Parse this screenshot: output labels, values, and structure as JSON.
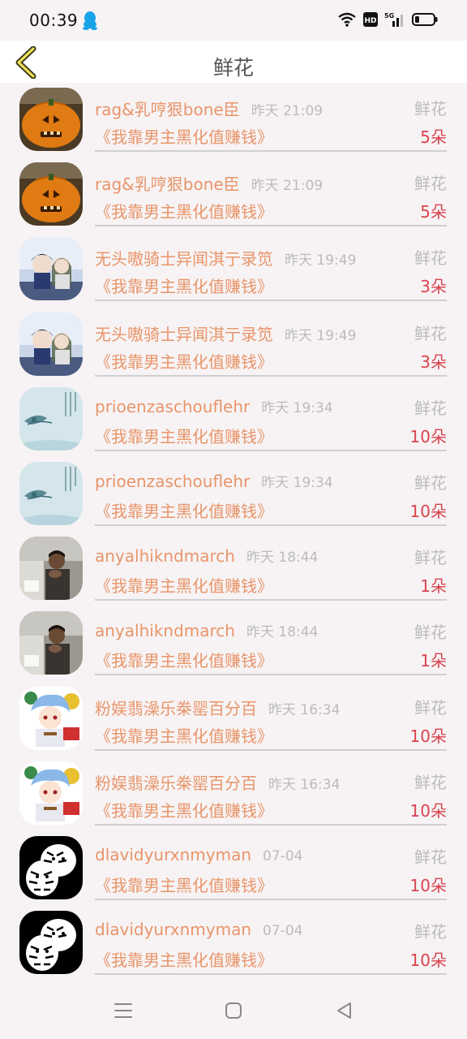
{
  "status": {
    "time": "00:39"
  },
  "header": {
    "title": "鲜花"
  },
  "items": [
    {
      "name": "rag&乳哼狠bone臣",
      "time": "昨天 21:09",
      "type": "鲜花",
      "book": "《我靠男主黑化值赚钱》",
      "count": "5朵",
      "avatar": "pumpkin"
    },
    {
      "name": "rag&乳哼狠bone臣",
      "time": "昨天 21:09",
      "type": "鲜花",
      "book": "《我靠男主黑化值赚钱》",
      "count": "5朵",
      "avatar": "pumpkin"
    },
    {
      "name": "无头嗷骑士异闻淇亍录笕",
      "time": "昨天 19:49",
      "type": "鲜花",
      "book": "《我靠男主黑化值赚钱》",
      "count": "3朵",
      "avatar": "anime-couple"
    },
    {
      "name": "无头嗷骑士异闻淇亍录笕",
      "time": "昨天 19:49",
      "type": "鲜花",
      "book": "《我靠男主黑化值赚钱》",
      "count": "3朵",
      "avatar": "anime-couple"
    },
    {
      "name": "prioenzaschouflehr",
      "time": "昨天 19:34",
      "type": "鲜花",
      "book": "《我靠男主黑化值赚钱》",
      "count": "10朵",
      "avatar": "ink-painting"
    },
    {
      "name": "prioenzaschouflehr",
      "time": "昨天 19:34",
      "type": "鲜花",
      "book": "《我靠男主黑化值赚钱》",
      "count": "10朵",
      "avatar": "ink-painting"
    },
    {
      "name": "anyalhikndmarch",
      "time": "昨天 18:44",
      "type": "鲜花",
      "book": "《我靠男主黑化值赚钱》",
      "count": "1朵",
      "avatar": "photo-person"
    },
    {
      "name": "anyalhikndmarch",
      "time": "昨天 18:44",
      "type": "鲜花",
      "book": "《我靠男主黑化值赚钱》",
      "count": "1朵",
      "avatar": "photo-person"
    },
    {
      "name": "粉娱翡澡乐桊罂百分百",
      "time": "昨天 16:34",
      "type": "鲜花",
      "book": "《我靠男主黑化值赚钱》",
      "count": "10朵",
      "avatar": "anime-boy"
    },
    {
      "name": "粉娱翡澡乐桊罂百分百",
      "time": "昨天 16:34",
      "type": "鲜花",
      "book": "《我靠男主黑化值赚钱》",
      "count": "10朵",
      "avatar": "anime-boy"
    },
    {
      "name": "dlavidyurxnmyman",
      "time": "07-04",
      "type": "鲜花",
      "book": "《我靠男主黑化值赚钱》",
      "count": "10朵",
      "avatar": "tiger"
    },
    {
      "name": "dlavidyurxnmyman",
      "time": "07-04",
      "type": "鲜花",
      "book": "《我靠男主黑化值赚钱》",
      "count": "10朵",
      "avatar": "tiger"
    }
  ],
  "nav": {
    "icons": [
      "menu-icon",
      "home-icon",
      "back-icon"
    ]
  },
  "colors": {
    "accent": "#e8956a",
    "count": "#d9434e",
    "muted": "#bbbbbb"
  }
}
